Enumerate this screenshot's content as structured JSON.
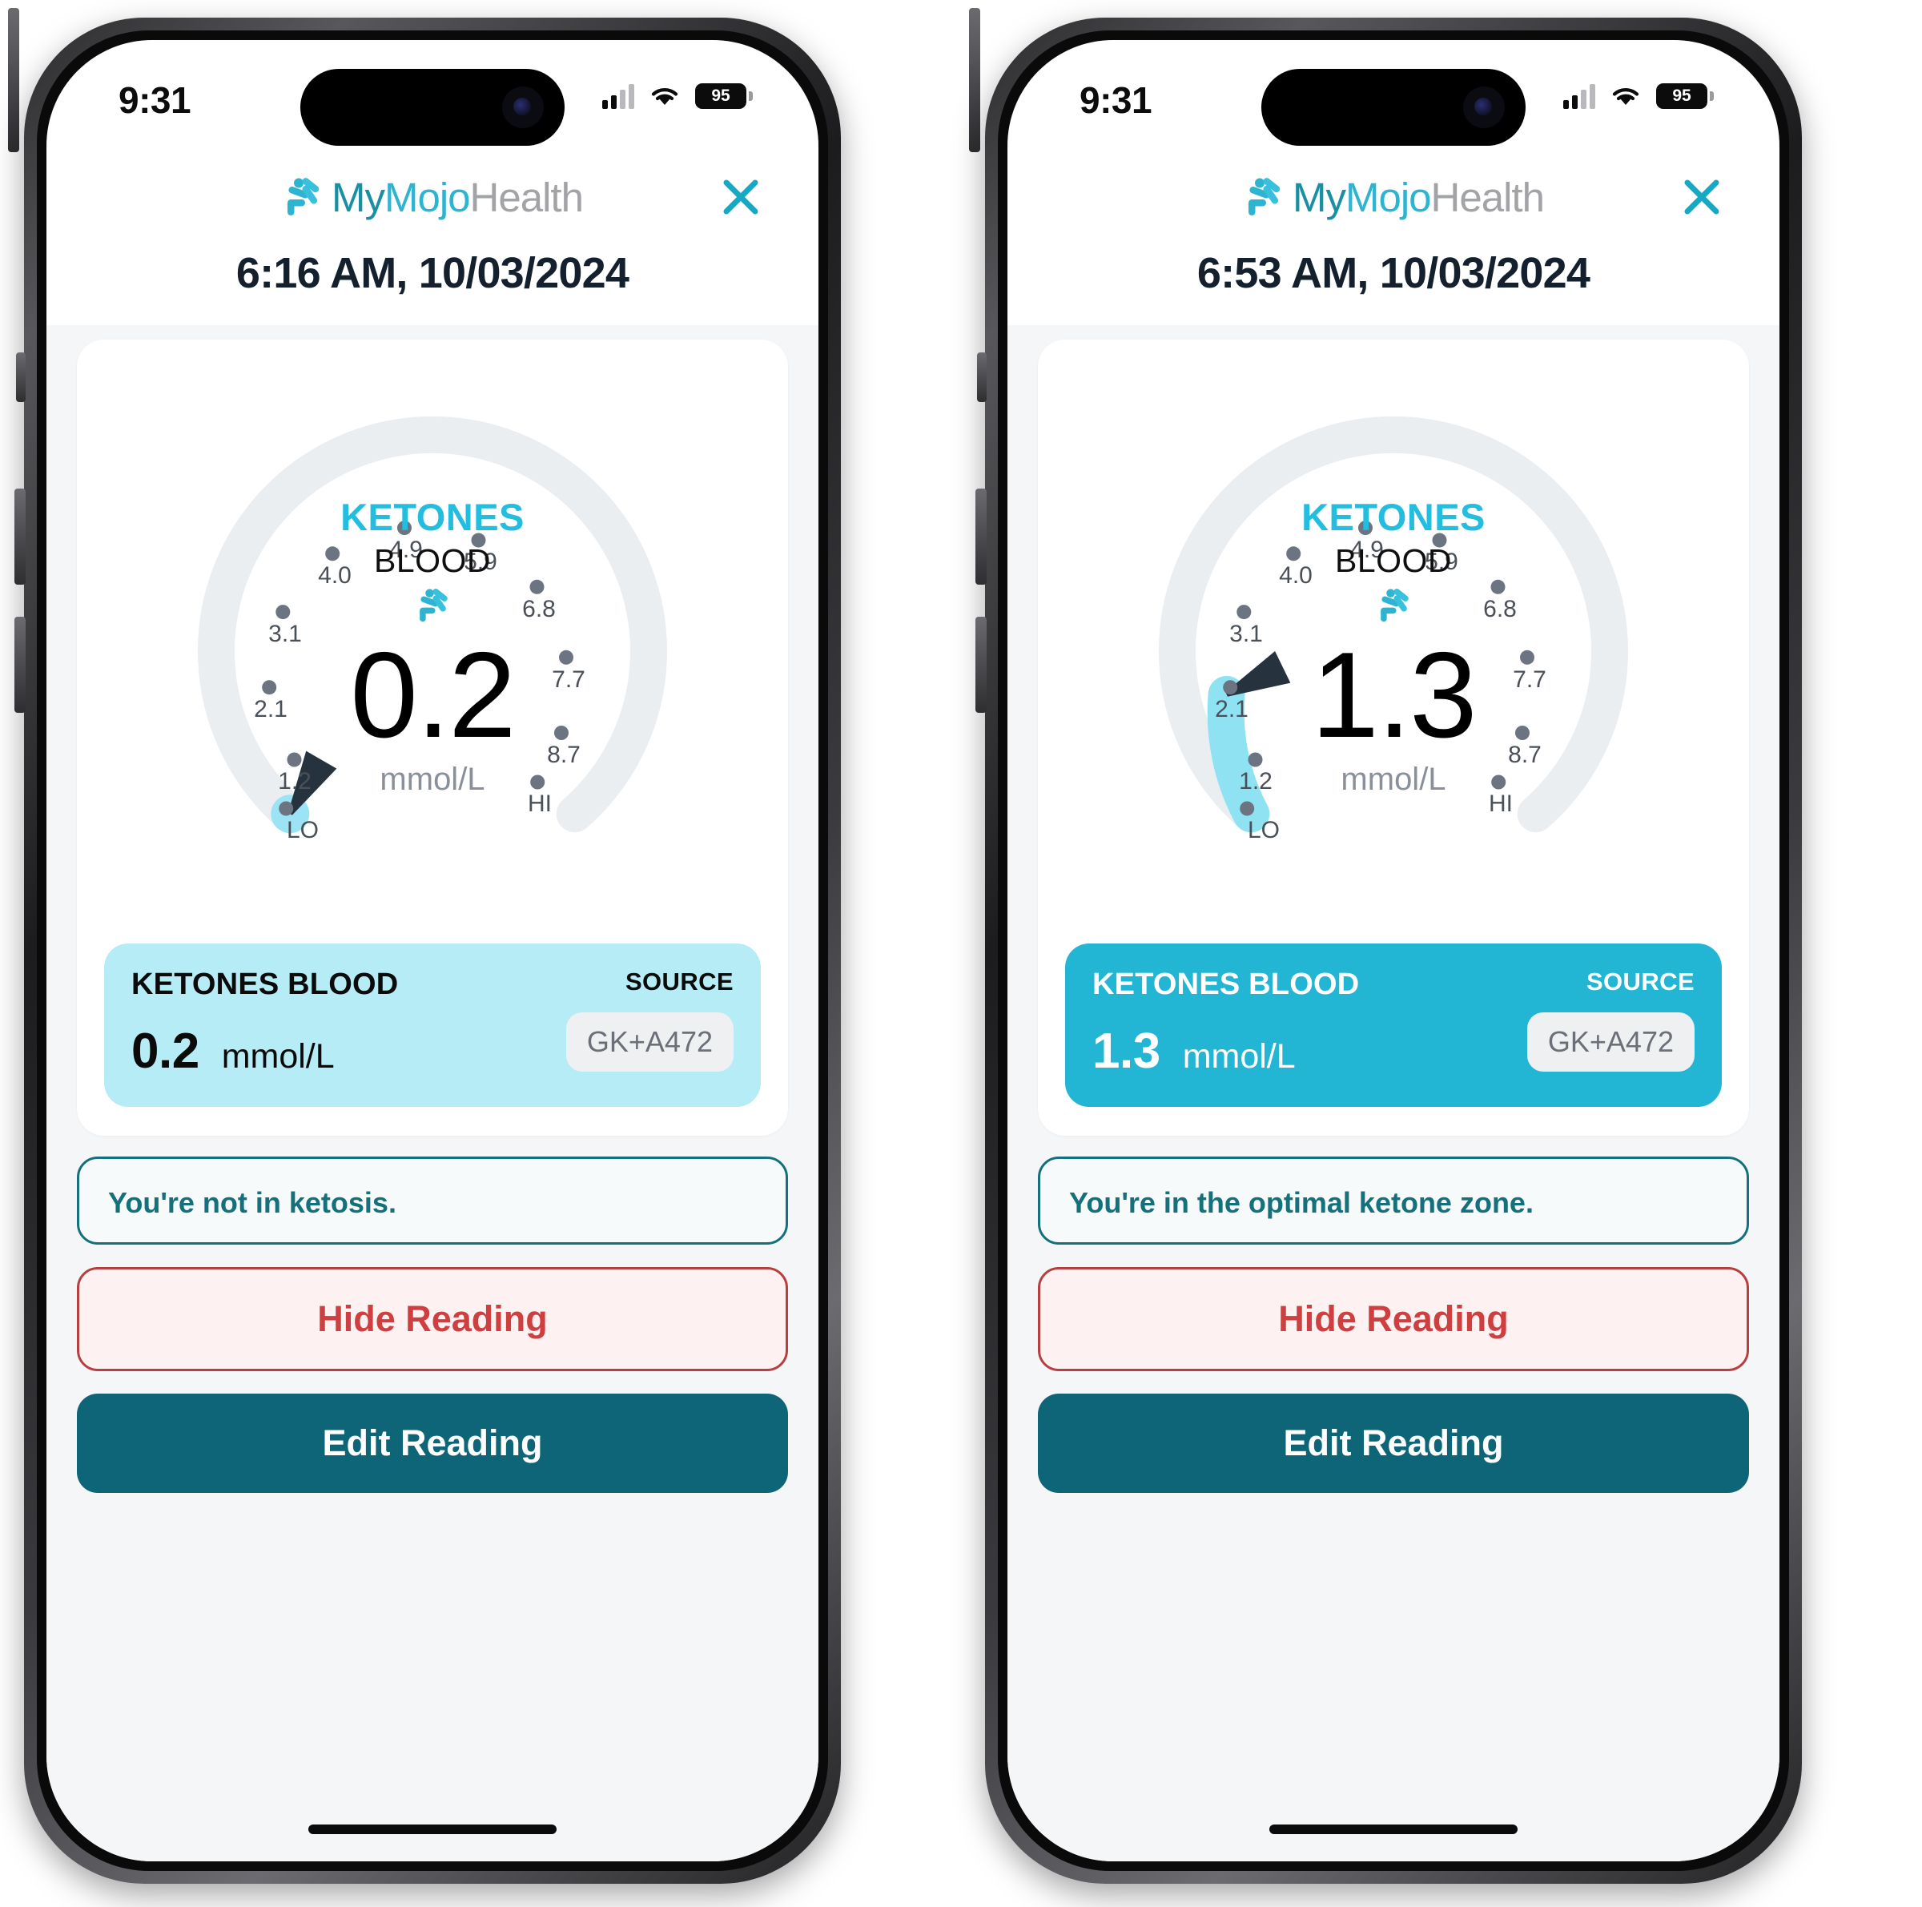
{
  "brand": {
    "my": "My",
    "mojo": "Mojo",
    "health": "Health",
    "mark_icon": "mymojo-runner-icon",
    "colors": {
      "my": "#1a8fa3",
      "mojo": "#2cb4d1",
      "health": "#a2a3a6"
    }
  },
  "status_bar": {
    "time": "9:31",
    "battery_percent": "95",
    "cellular_icon": "cellular-signal-icon",
    "wifi_icon": "wifi-icon",
    "battery_icon": "battery-icon"
  },
  "close_icon": "close-x-icon",
  "gauge_common": {
    "title": "KETONES",
    "subtitle": "BLOOD",
    "unit": "mmol/L",
    "icon": "mymojo-runner-icon",
    "lo_label": "LO",
    "hi_label": "HI",
    "tick_labels": [
      "1.2",
      "2.1",
      "3.1",
      "4.0",
      "4.9",
      "5.9",
      "6.8",
      "7.7",
      "8.7"
    ],
    "track_color": "#eaeef1",
    "fill_color": "#8fe2f2",
    "needle_color": "#26333f",
    "title_color": "#22bddf"
  },
  "chart_data": [
    {
      "type": "gauge",
      "title": "KETONES BLOOD",
      "value": 0.2,
      "unit": "mmol/L",
      "range_min": 0,
      "range_max": 9.5,
      "tick_values": [
        1.2,
        2.1,
        3.1,
        4.0,
        4.9,
        5.9,
        6.8,
        7.7,
        8.7
      ],
      "tick_labels": [
        "1.2",
        "2.1",
        "3.1",
        "4.0",
        "4.9",
        "5.9",
        "6.8",
        "7.7",
        "8.7"
      ],
      "endpoint_labels": [
        "LO",
        "HI"
      ],
      "arc_start_deg": 145,
      "arc_sweep_deg": 250,
      "fill_fraction": 0.02,
      "needle_value": 0.2,
      "annotation": "You're not in ketosis."
    },
    {
      "type": "gauge",
      "title": "KETONES BLOOD",
      "value": 1.3,
      "unit": "mmol/L",
      "range_min": 0,
      "range_max": 9.5,
      "tick_values": [
        1.2,
        2.1,
        3.1,
        4.0,
        4.9,
        5.9,
        6.8,
        7.7,
        8.7
      ],
      "tick_labels": [
        "1.2",
        "2.1",
        "3.1",
        "4.0",
        "4.9",
        "5.9",
        "6.8",
        "7.7",
        "8.7"
      ],
      "endpoint_labels": [
        "LO",
        "HI"
      ],
      "arc_start_deg": 145,
      "arc_sweep_deg": 250,
      "fill_fraction": 0.137,
      "needle_value": 1.3,
      "annotation": "You're in the optimal ketone zone."
    }
  ],
  "phones": [
    {
      "datetime": "6:16 AM, 10/03/2024",
      "gauge_value": "0.2",
      "reading": {
        "name": "KETONES BLOOD",
        "value": "0.2",
        "unit": "mmol/L",
        "source_label": "SOURCE",
        "source_value": "GK+A472",
        "style": "low"
      },
      "message": "You're not in ketosis.",
      "hide_button": "Hide Reading",
      "edit_button": "Edit Reading"
    },
    {
      "datetime": "6:53 AM, 10/03/2024",
      "gauge_value": "1.3",
      "reading": {
        "name": "KETONES BLOOD",
        "value": "1.3",
        "unit": "mmol/L",
        "source_label": "SOURCE",
        "source_value": "GK+A472",
        "style": "high"
      },
      "message": "You're in the optimal ketone zone.",
      "hide_button": "Hide Reading",
      "edit_button": "Edit Reading"
    }
  ]
}
